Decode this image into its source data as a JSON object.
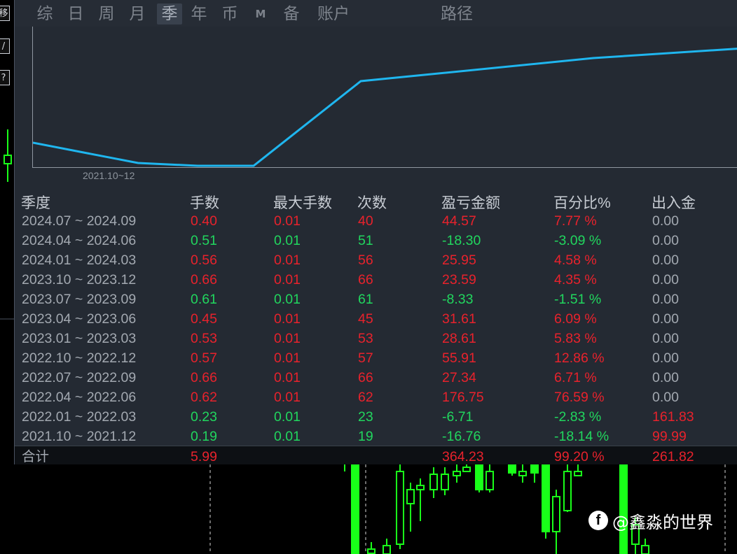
{
  "left_buttons": [
    "移",
    "/",
    "?"
  ],
  "tabs": [
    {
      "label": "综",
      "active": false
    },
    {
      "label": "日",
      "active": false
    },
    {
      "label": "周",
      "active": false
    },
    {
      "label": "月",
      "active": false
    },
    {
      "label": "季",
      "active": true
    },
    {
      "label": "年",
      "active": false
    },
    {
      "label": "币",
      "active": false
    },
    {
      "label": "M",
      "active": false
    },
    {
      "label": "备",
      "active": false
    },
    {
      "label": "账户",
      "active": false
    },
    {
      "label": "路径",
      "active": false
    }
  ],
  "equity_chart": {
    "x_tick_label": "2021.10~12",
    "line_color": "#1fb6ef"
  },
  "table": {
    "headers": {
      "quarter": "季度",
      "lots": "手数",
      "max_lots": "最大手数",
      "count": "次数",
      "pnl": "盈亏金额",
      "percent": "百分比%",
      "deposit": "出入金"
    },
    "rows": [
      {
        "quarter": "2024.07 ~ 2024.09",
        "lots": "0.40",
        "max_lots": "0.01",
        "count": "40",
        "pnl": "44.57",
        "percent": "7.77 %",
        "deposit": "0.00",
        "sign": "pos",
        "deposit_highlight": false
      },
      {
        "quarter": "2024.04 ~ 2024.06",
        "lots": "0.51",
        "max_lots": "0.01",
        "count": "51",
        "pnl": "-18.30",
        "percent": "-3.09 %",
        "deposit": "0.00",
        "sign": "neg",
        "deposit_highlight": false
      },
      {
        "quarter": "2024.01 ~ 2024.03",
        "lots": "0.56",
        "max_lots": "0.01",
        "count": "56",
        "pnl": "25.95",
        "percent": "4.58 %",
        "deposit": "0.00",
        "sign": "pos",
        "deposit_highlight": false
      },
      {
        "quarter": "2023.10 ~ 2023.12",
        "lots": "0.66",
        "max_lots": "0.01",
        "count": "66",
        "pnl": "23.59",
        "percent": "4.35 %",
        "deposit": "0.00",
        "sign": "pos",
        "deposit_highlight": false
      },
      {
        "quarter": "2023.07 ~ 2023.09",
        "lots": "0.61",
        "max_lots": "0.01",
        "count": "61",
        "pnl": "-8.33",
        "percent": "-1.51 %",
        "deposit": "0.00",
        "sign": "neg",
        "deposit_highlight": false
      },
      {
        "quarter": "2023.04 ~ 2023.06",
        "lots": "0.45",
        "max_lots": "0.01",
        "count": "45",
        "pnl": "31.61",
        "percent": "6.09 %",
        "deposit": "0.00",
        "sign": "pos",
        "deposit_highlight": false
      },
      {
        "quarter": "2023.01 ~ 2023.03",
        "lots": "0.53",
        "max_lots": "0.01",
        "count": "53",
        "pnl": "28.61",
        "percent": "5.83 %",
        "deposit": "0.00",
        "sign": "pos",
        "deposit_highlight": false
      },
      {
        "quarter": "2022.10 ~ 2022.12",
        "lots": "0.57",
        "max_lots": "0.01",
        "count": "57",
        "pnl": "55.91",
        "percent": "12.86 %",
        "deposit": "0.00",
        "sign": "pos",
        "deposit_highlight": false
      },
      {
        "quarter": "2022.07 ~ 2022.09",
        "lots": "0.66",
        "max_lots": "0.01",
        "count": "66",
        "pnl": "27.34",
        "percent": "6.71 %",
        "deposit": "0.00",
        "sign": "pos",
        "deposit_highlight": false
      },
      {
        "quarter": "2022.04 ~ 2022.06",
        "lots": "0.62",
        "max_lots": "0.01",
        "count": "62",
        "pnl": "176.75",
        "percent": "76.59 %",
        "deposit": "0.00",
        "sign": "pos",
        "deposit_highlight": false
      },
      {
        "quarter": "2022.01 ~ 2022.03",
        "lots": "0.23",
        "max_lots": "0.01",
        "count": "23",
        "pnl": "-6.71",
        "percent": "-2.83 %",
        "deposit": "161.83",
        "sign": "neg",
        "deposit_highlight": true
      },
      {
        "quarter": "2021.10 ~ 2021.12",
        "lots": "0.19",
        "max_lots": "0.01",
        "count": "19",
        "pnl": "-16.76",
        "percent": "-18.14 %",
        "deposit": "99.99",
        "sign": "neg",
        "deposit_highlight": true
      }
    ],
    "total": {
      "label": "合计",
      "lots": "5.99",
      "pnl": "364.23",
      "percent": "99.20 %",
      "deposit": "261.82"
    }
  },
  "colors": {
    "positive": "#e8222c",
    "negative": "#21d65e",
    "candle_green": "#19ff19",
    "panel_bg": "#242a33"
  },
  "watermark": {
    "logo": "f",
    "text": "@鑫淼的世界"
  }
}
